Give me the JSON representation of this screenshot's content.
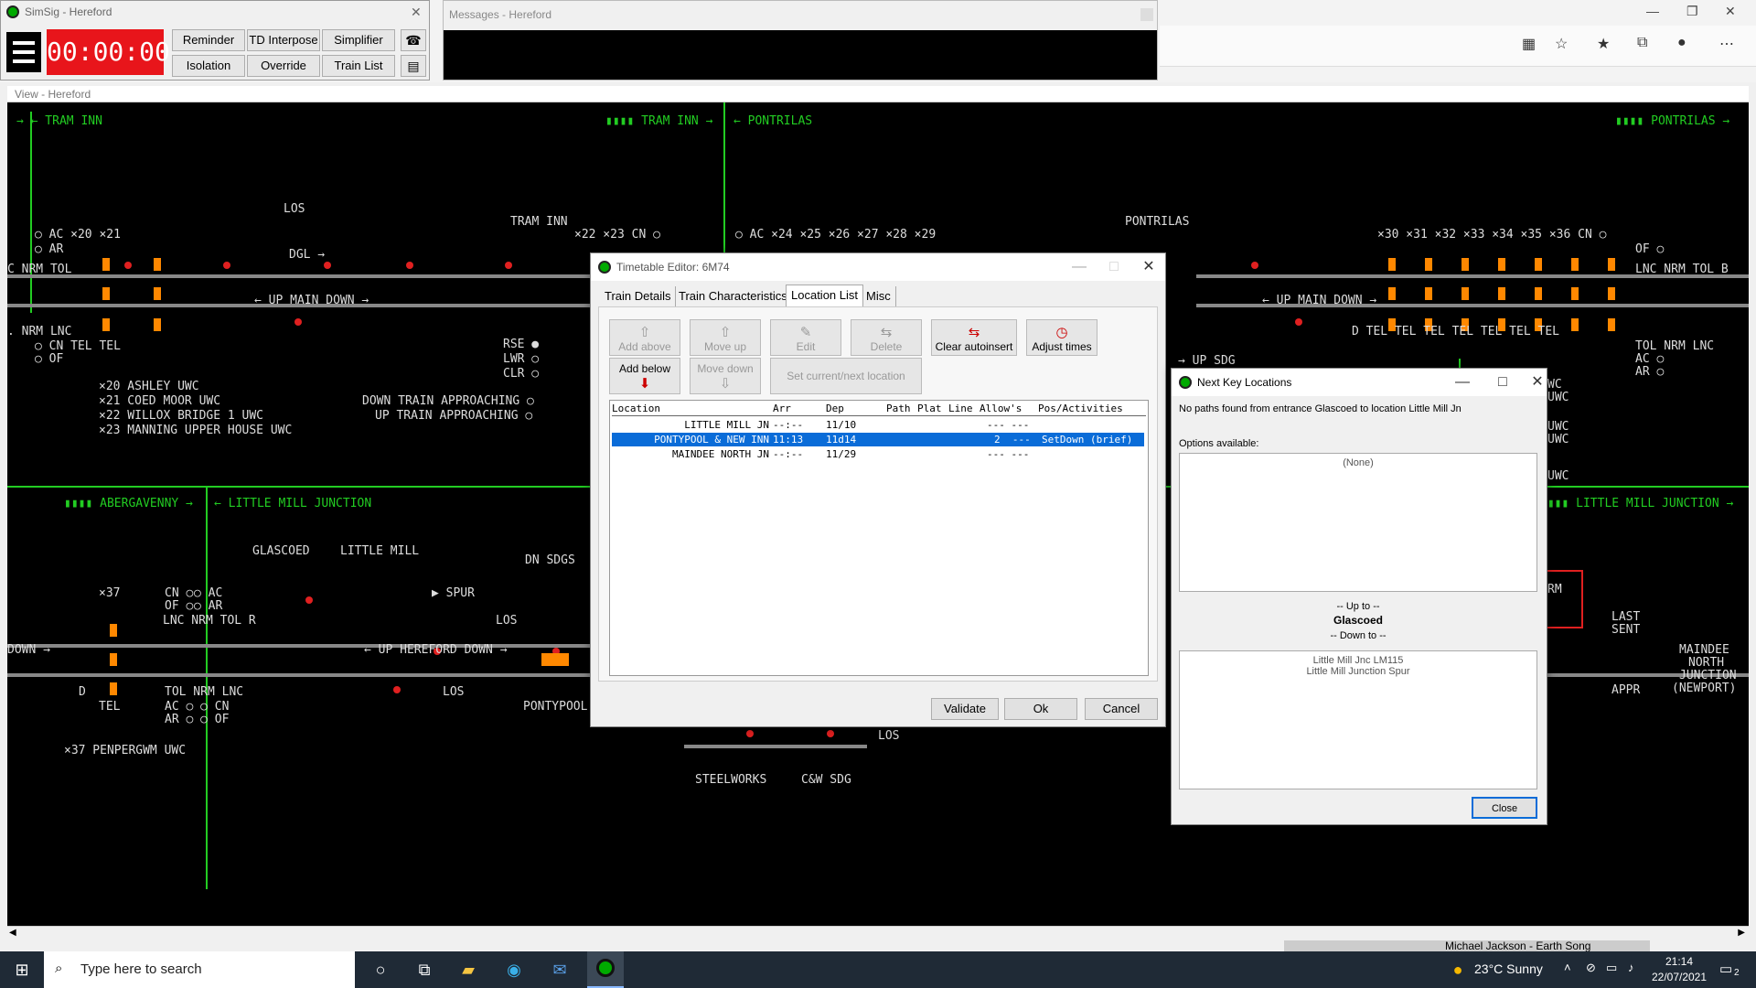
{
  "simsig": {
    "title": "SimSig - Hereford",
    "clock": "00:00:00",
    "buttons": [
      "Reminder",
      "TD Interpose",
      "Simplifier",
      "Isolation",
      "Override",
      "Train List"
    ]
  },
  "messages": {
    "title": "Messages - Hereford"
  },
  "view": {
    "title": "View - Hereford",
    "labels": [
      {
        "t": "→ ← TRAM INN",
        "c": "green"
      },
      {
        "t": "▮▮▮▮ TRAM INN →",
        "c": "green"
      },
      {
        "t": "← PONTRILAS",
        "c": "green"
      },
      {
        "t": "▮▮▮▮ PONTRILAS →",
        "c": "green"
      },
      {
        "t": "LOS",
        "c": "white"
      },
      {
        "t": "DGL →",
        "c": "white"
      },
      {
        "t": "TRAM INN",
        "c": "white"
      },
      {
        "t": "PONTRILAS",
        "c": "white"
      },
      {
        "t": "○ AC  ×20   ×21",
        "c": "white"
      },
      {
        "t": "○ AR",
        "c": "white"
      },
      {
        "t": "×22     ×23  CN ○",
        "c": "white"
      },
      {
        "t": "○ AC ×24  ×25  ×26  ×27   ×28  ×29",
        "c": "white"
      },
      {
        "t": "×30  ×31  ×32  ×33  ×34  ×35  ×36  CN ○",
        "c": "white"
      },
      {
        "t": "OF ○",
        "c": "white"
      },
      {
        "t": "C NRM TOL",
        "c": "white"
      },
      {
        "t": "LNC NRM TOL  B",
        "c": "white"
      },
      {
        "t": "← UP MAIN DOWN →",
        "c": "white"
      },
      {
        "t": "← UP MAIN DOWN →",
        "c": "white"
      },
      {
        "t": ". NRM LNC",
        "c": "white"
      },
      {
        "t": "○ CN   TEL     TEL",
        "c": "white"
      },
      {
        "t": "○ OF",
        "c": "white"
      },
      {
        "t": "RSE ●",
        "c": "white"
      },
      {
        "t": "LWR ○",
        "c": "white"
      },
      {
        "t": "CLR ○",
        "c": "white"
      },
      {
        "t": "D  TEL  TEL  TEL  TEL  TEL  TEL  TEL",
        "c": "white"
      },
      {
        "t": "TOL NRM LNC",
        "c": "white"
      },
      {
        "t": "AC ○",
        "c": "white"
      },
      {
        "t": "AR ○",
        "c": "white"
      },
      {
        "t": "×20 ASHLEY UWC",
        "c": "white"
      },
      {
        "t": "×21 COED MOOR UWC",
        "c": "white"
      },
      {
        "t": "×22 WILLOX BRIDGE 1 UWC",
        "c": "white"
      },
      {
        "t": "×23 MANNING UPPER HOUSE UWC",
        "c": "white"
      },
      {
        "t": "DOWN TRAIN APPROACHING ○",
        "c": "white"
      },
      {
        "t": "UP TRAIN APPROACHING ○",
        "c": "white"
      },
      {
        "t": "▮▮▮▮ ABERGAVENNY →",
        "c": "green"
      },
      {
        "t": "← LITTLE MILL JUNCTION",
        "c": "green"
      },
      {
        "t": "▮▮▮▮ LITTLE MILL JUNCTION →",
        "c": "green"
      },
      {
        "t": "GLASCOED",
        "c": "white"
      },
      {
        "t": "LITTLE MILL",
        "c": "white"
      },
      {
        "t": "DN SDGS",
        "c": "white"
      },
      {
        "t": "×37",
        "c": "white"
      },
      {
        "t": "CN ○",
        "c": "white"
      },
      {
        "t": "OF ○",
        "c": "white"
      },
      {
        "t": "○ AC",
        "c": "white"
      },
      {
        "t": "○ AR",
        "c": "white"
      },
      {
        "t": "▶ SPUR",
        "c": "white"
      },
      {
        "t": "LNC NRM TOL R",
        "c": "white"
      },
      {
        "t": "LOS",
        "c": "white"
      },
      {
        "t": "DOWN →",
        "c": "white"
      },
      {
        "t": "← UP HEREFORD DOWN →",
        "c": "white"
      },
      {
        "t": "D",
        "c": "white"
      },
      {
        "t": "TEL",
        "c": "white"
      },
      {
        "t": "TOL NRM LNC",
        "c": "white"
      },
      {
        "t": "AC ○  ○ CN",
        "c": "white"
      },
      {
        "t": "AR ○  ○ OF",
        "c": "white"
      },
      {
        "t": "LOS",
        "c": "white"
      },
      {
        "t": "PONTYPOOL",
        "c": "white"
      },
      {
        "t": "×37 PENPERGWM UWC",
        "c": "white"
      },
      {
        "t": "LOS",
        "c": "white"
      },
      {
        "t": "STEELWORKS",
        "c": "white"
      },
      {
        "t": "C&W SDG",
        "c": "white"
      },
      {
        "t": "LAST",
        "c": "white"
      },
      {
        "t": "SENT",
        "c": "white"
      },
      {
        "t": "APPR",
        "c": "white"
      },
      {
        "t": "MAINDEE",
        "c": "white"
      },
      {
        "t": "NORTH",
        "c": "white"
      },
      {
        "t": "JUNCTION",
        "c": "white"
      },
      {
        "t": "(NEWPORT)",
        "c": "white"
      },
      {
        "t": "WC",
        "c": "white"
      },
      {
        "t": "UWC",
        "c": "white"
      },
      {
        "t": "UWC",
        "c": "white"
      },
      {
        "t": "UWC",
        "c": "white"
      },
      {
        "t": "UWC",
        "c": "white"
      },
      {
        "t": "RM",
        "c": "white"
      },
      {
        "t": "→ UP SDG",
        "c": "white"
      }
    ]
  },
  "timetable": {
    "title": "Timetable Editor: 6M74",
    "tabs": [
      "Train Details",
      "Train Characteristics",
      "Location List",
      "Misc"
    ],
    "active_tab": "Location List",
    "toolbar": {
      "add_above": "Add above",
      "move_up": "Move up",
      "edit": "Edit",
      "delete": "Delete",
      "clear_autoinsert": "Clear autoinsert",
      "adjust_times": "Adjust times",
      "add_below": "Add below",
      "move_down": "Move down",
      "set_current": "Set current/next location"
    },
    "columns": [
      "Location",
      "Arr",
      "Dep",
      "Path",
      "Plat",
      "Line",
      "Allow's",
      "Pos/Activities"
    ],
    "rows": [
      {
        "location": "LITTLE MILL JN",
        "arr": "--:--",
        "dep": "11/10",
        "path": "",
        "plat": "",
        "line": "",
        "allow": "--- ---",
        "activities": ""
      },
      {
        "location": "PONTYPOOL & NEW INN",
        "arr": "11:13",
        "dep": "11d14",
        "path": "",
        "plat": "",
        "line": "",
        "allow": "2  ---",
        "activities": "SetDown (brief)"
      },
      {
        "location": "MAINDEE NORTH JN",
        "arr": "--:--",
        "dep": "11/29",
        "path": "",
        "plat": "",
        "line": "",
        "allow": "--- ---",
        "activities": ""
      }
    ],
    "selected_row": 1,
    "buttons": {
      "validate": "Validate",
      "ok": "Ok",
      "cancel": "Cancel"
    }
  },
  "nextkey": {
    "title": "Next Key Locations",
    "message": "No paths found from entrance Glascoed to location Little Mill Jn",
    "options_label": "Options available:",
    "options_value": "(None)",
    "upto_label": "-- Up to --",
    "upto_value": "Glascoed",
    "downto_label": "-- Down to --",
    "list": [
      "Little Mill Jnc LM115",
      "Little Mill Junction Spur"
    ],
    "close": "Close"
  },
  "taskbar": {
    "search_placeholder": "Type here to search",
    "weather": "23°C  Sunny",
    "time": "21:14",
    "date": "22/07/2021",
    "notification_count": "2",
    "media": "Michael Jackson - Earth Song"
  },
  "colors": {
    "track_green": "#22cc22",
    "signal_red": "#e02020",
    "signal_orange": "#ff8800",
    "selection": "#0a6cd8",
    "clock_red": "#e8151b"
  }
}
